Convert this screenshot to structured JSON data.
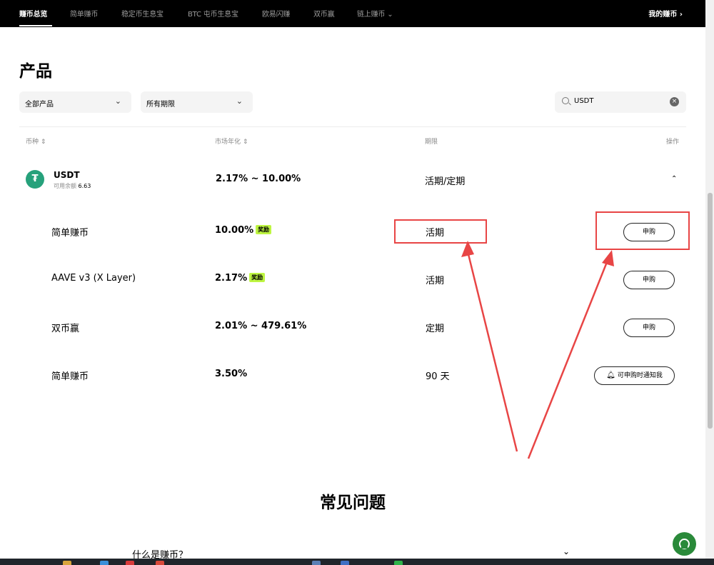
{
  "nav": {
    "items": [
      "赚币总览",
      "简单赚币",
      "稳定币生息宝",
      "BTC 屯币生息宝",
      "欧易闪赚",
      "双币赢",
      "链上赚币"
    ],
    "right_label": "我的赚币"
  },
  "page_title": "产品",
  "filters": {
    "product": "全部产品",
    "term": "所有期限",
    "search_value": "USDT"
  },
  "table": {
    "headers": [
      "币种",
      "市场年化",
      "期限",
      "操作"
    ],
    "coin": {
      "name": "USDT",
      "balance_label": "可用余额",
      "balance_value": "6.63",
      "rate": "2.17% ~ 10.00%",
      "term": "活期/定期"
    },
    "rows": [
      {
        "name": "简单赚币",
        "rate": "10.00%",
        "badge": "奖励",
        "term": "活期",
        "action": "申购"
      },
      {
        "name": "AAVE v3 (X Layer)",
        "rate": "2.17%",
        "badge": "奖励",
        "term": "活期",
        "action": "申购"
      },
      {
        "name": "双币赢",
        "rate": "2.01% ~ 479.61%",
        "badge": "",
        "term": "定期",
        "action": "申购"
      },
      {
        "name": "简单赚币",
        "rate": "3.50%",
        "badge": "",
        "term": "90 天",
        "action": "可申购时通知我"
      }
    ]
  },
  "faq": {
    "title": "常见问题",
    "question": "什么是赚币？"
  },
  "colors": {
    "highlight": "#e84545",
    "badge": "#bef542",
    "usdt": "#26a17b",
    "support": "#2a8a3a"
  }
}
